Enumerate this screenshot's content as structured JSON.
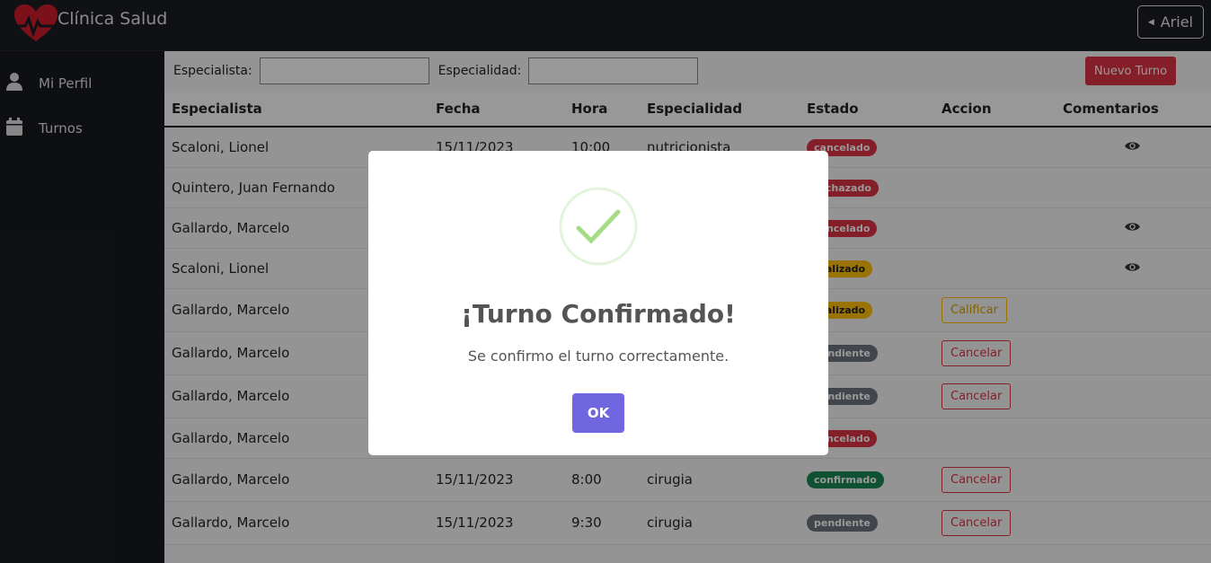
{
  "header": {
    "title": "Clínica Salud",
    "user": "Ariel"
  },
  "sidebar": {
    "items": [
      {
        "label": "Mi Perfil",
        "icon": "user-icon"
      },
      {
        "label": "Turnos",
        "icon": "calendar-icon"
      }
    ]
  },
  "filters": {
    "especialista_label": "Especialista:",
    "especialidad_label": "Especialidad:",
    "new_button": "Nuevo Turno"
  },
  "table": {
    "headers": [
      "Especialista",
      "Fecha",
      "Hora",
      "Especialidad",
      "Estado",
      "Accion",
      "Comentarios"
    ],
    "rows": [
      {
        "especialista": "Scaloni, Lionel",
        "fecha": "15/11/2023",
        "hora": "10:00",
        "especialidad": "nutricionista",
        "estado": "cancelado",
        "accion": "",
        "comentario": true
      },
      {
        "especialista": "Quintero, Juan Fernando",
        "fecha": "",
        "hora": "",
        "especialidad": "",
        "estado": "rechazado",
        "accion": "",
        "comentario": false
      },
      {
        "especialista": "Gallardo, Marcelo",
        "fecha": "",
        "hora": "",
        "especialidad": "",
        "estado": "cancelado",
        "accion": "",
        "comentario": true
      },
      {
        "especialista": "Scaloni, Lionel",
        "fecha": "",
        "hora": "",
        "especialidad": "",
        "estado": "realizado",
        "accion": "",
        "comentario": true
      },
      {
        "especialista": "Gallardo, Marcelo",
        "fecha": "",
        "hora": "",
        "especialidad": "",
        "estado": "realizado",
        "accion": "Calificar",
        "comentario": false
      },
      {
        "especialista": "Gallardo, Marcelo",
        "fecha": "",
        "hora": "",
        "especialidad": "",
        "estado": "pendiente",
        "accion": "Cancelar",
        "comentario": false
      },
      {
        "especialista": "Gallardo, Marcelo",
        "fecha": "",
        "hora": "",
        "especialidad": "",
        "estado": "pendiente",
        "accion": "Cancelar",
        "comentario": false
      },
      {
        "especialista": "Gallardo, Marcelo",
        "fecha": "",
        "hora": "",
        "especialidad": "",
        "estado": "cancelado",
        "accion": "",
        "comentario": false
      },
      {
        "especialista": "Gallardo, Marcelo",
        "fecha": "15/11/2023",
        "hora": "8:00",
        "especialidad": "cirugia",
        "estado": "confirmado",
        "accion": "Cancelar",
        "comentario": false
      },
      {
        "especialista": "Gallardo, Marcelo",
        "fecha": "15/11/2023",
        "hora": "9:30",
        "especialidad": "cirugia",
        "estado": "pendiente",
        "accion": "Cancelar",
        "comentario": false
      }
    ]
  },
  "modal": {
    "title": "¡Turno Confirmado!",
    "text": "Se confirmo el turno correctamente.",
    "ok": "OK",
    "icon": "success-check-icon"
  },
  "colors": {
    "danger": "#dc3545",
    "warning": "#ffc107",
    "success": "#198754",
    "secondary": "#6c757d",
    "ok_button": "#7066e0"
  }
}
